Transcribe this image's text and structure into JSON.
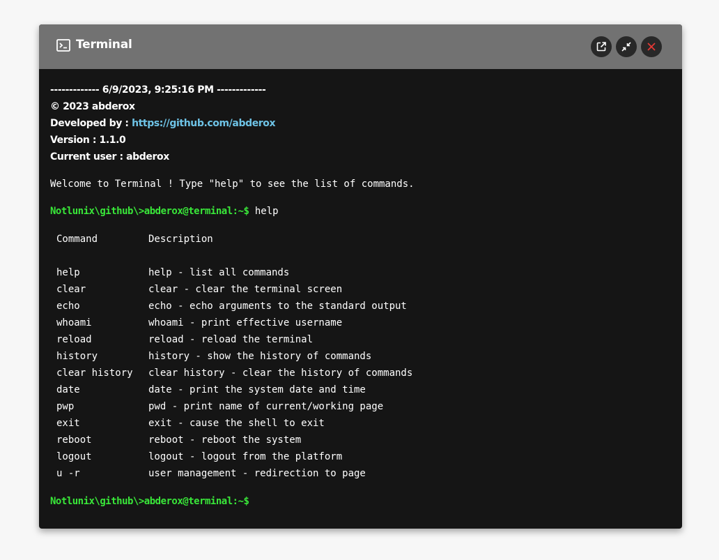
{
  "window": {
    "title": "Terminal",
    "icons": [
      "terminal-icon",
      "open-external-icon",
      "minimize-icon",
      "close-icon"
    ],
    "colors": {
      "titlebar": "#727272",
      "background": "#151515",
      "prompt": "#39e639",
      "link": "#6ec3e6",
      "close": "#e53935"
    }
  },
  "info": {
    "header": "------------- 6/9/2023, 9:25:16 PM -------------",
    "copyright": "© 2023 abderox",
    "developed_label": "Developed by : ",
    "developed_link": "https://github.com/abderox",
    "version": "Version : 1.1.0",
    "current_user": "Current user : abderox"
  },
  "welcome": "Welcome to Terminal ! Type \"help\" to see the list of commands.",
  "session": {
    "prompt": "Notlunix\\github\\>abderox@terminal:~$",
    "command": " help"
  },
  "help_table": {
    "headers": [
      "Command",
      "Description"
    ],
    "rows": [
      [
        "help",
        "help - list all commands"
      ],
      [
        "clear",
        "clear - clear the terminal screen"
      ],
      [
        "echo",
        "echo - echo arguments to the standard output"
      ],
      [
        "whoami",
        "whoami - print effective username"
      ],
      [
        "reload",
        "reload - reload the terminal"
      ],
      [
        "history",
        "history - show the history of commands"
      ],
      [
        "clear history",
        "clear history - clear the history of commands"
      ],
      [
        "date",
        "date - print the system date and time"
      ],
      [
        "pwp",
        "pwd - print name of current/working page"
      ],
      [
        "exit",
        "exit - cause the shell to exit"
      ],
      [
        "reboot",
        "reboot - reboot the system"
      ],
      [
        "logout",
        "logout - logout from the platform"
      ],
      [
        "u -r",
        "user management - redirection to page"
      ]
    ]
  },
  "current_prompt": "Notlunix\\github\\>abderox@terminal:~$"
}
